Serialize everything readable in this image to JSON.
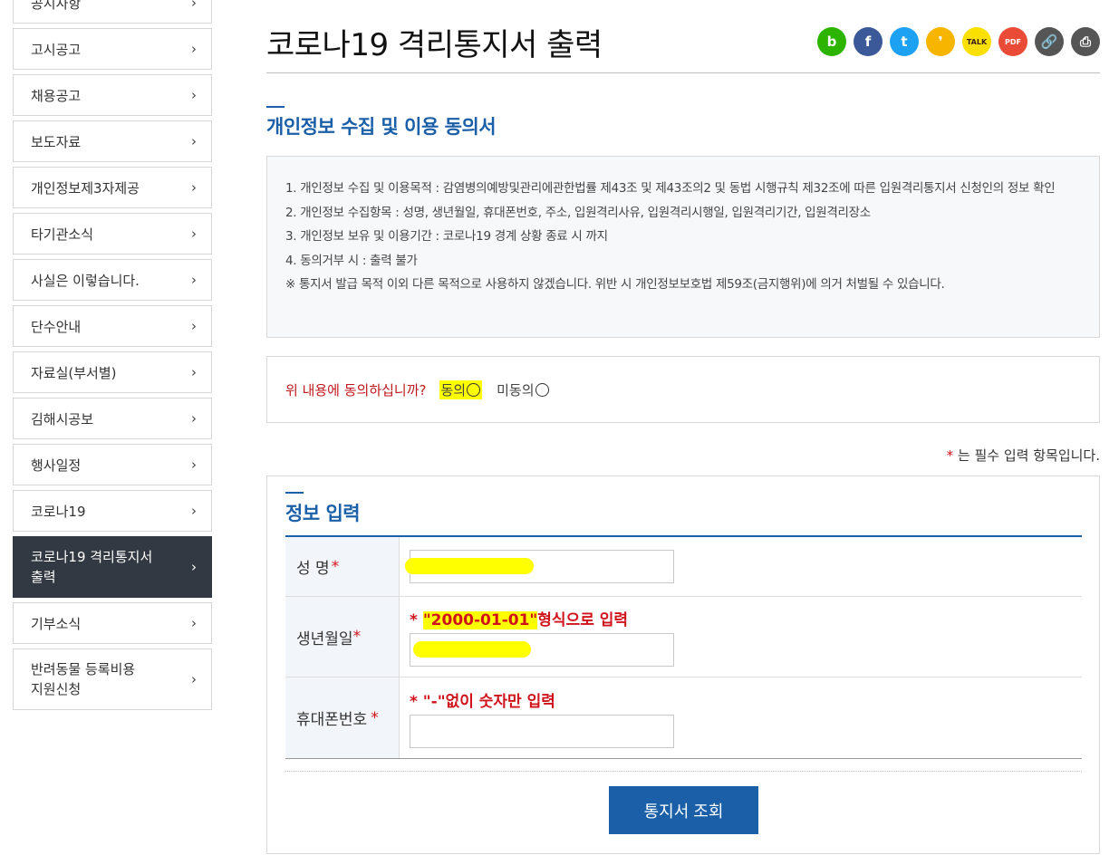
{
  "sidebar": {
    "items": [
      {
        "label": "공시사항"
      },
      {
        "label": "고시공고"
      },
      {
        "label": "채용공고"
      },
      {
        "label": "보도자료"
      },
      {
        "label": "개인정보제3자제공"
      },
      {
        "label": "타기관소식"
      },
      {
        "label": "사실은 이렇습니다."
      },
      {
        "label": "단수안내"
      },
      {
        "label": "자료실(부서별)"
      },
      {
        "label": "김해시공보"
      },
      {
        "label": "행사일정"
      },
      {
        "label": "코로나19"
      },
      {
        "label": "코로나19 격리통지서\n출력",
        "active": true
      },
      {
        "label": "기부소식"
      },
      {
        "label": "반려동물 등록비용\n지원신청"
      }
    ],
    "chevron": "›"
  },
  "page": {
    "title": "코로나19 격리통지서 출력"
  },
  "share": [
    {
      "icon": "band-icon",
      "glyph": "b",
      "color": "#2db400"
    },
    {
      "icon": "facebook-icon",
      "glyph": "f",
      "color": "#3b5998"
    },
    {
      "icon": "twitter-icon",
      "glyph": "t",
      "color": "#1da1f2"
    },
    {
      "icon": "kakaostory-icon",
      "glyph": "❜",
      "color": "#f8b500"
    },
    {
      "icon": "kakaotalk-icon",
      "glyph": "TALK",
      "color": "#f9e000"
    },
    {
      "icon": "pdf-icon",
      "glyph": "PDF",
      "color": "#e94b36"
    },
    {
      "icon": "link-icon",
      "glyph": "🔗",
      "color": "#555555"
    },
    {
      "icon": "print-icon",
      "glyph": "⎙",
      "color": "#555555"
    }
  ],
  "privacy": {
    "title": "개인정보 수집 및 이용 동의서",
    "lines": [
      "1. 개인정보 수집 및 이용목적 : 감염병의예방및관리에관한법률 제43조 및 제43조의2 및 동법 시행규칙 제32조에 따른 입원격리통지서 신청인의 정보 확인",
      "2. 개인정보 수집항목 : 성명, 생년월일, 휴대폰번호, 주소, 입원격리사유, 입원격리시행일, 입원격리기간, 입원격리장소",
      "3. 개인정보 보유 및 이용기간 : 코로나19 경계 상황 종료 시 까지",
      "4. 동의거부 시 : 출력 불가",
      "※ 통지서 발급 목적 이외 다른 목적으로 사용하지 않겠습니다. 위반 시 개인정보보호법 제59조(금지행위)에 의거 처벌될 수 있습니다."
    ]
  },
  "agree": {
    "question": "위 내용에 동의하십니까?",
    "yes_label": "동의",
    "no_label": "미동의"
  },
  "required_note": {
    "star": "*",
    "text": " 는 필수 입력 항목입니다."
  },
  "form": {
    "title": "정보 입력",
    "name_label": "성 명",
    "birth_label": "생년월일",
    "birth_hint_star": "* ",
    "birth_hint_fmt": "\"2000-01-01\"",
    "birth_hint_tail": "형식으로 입력",
    "phone_label": "휴대폰번호",
    "phone_hint": "* \"-\"없이 숫자만 입력",
    "star": "*",
    "name_value": "",
    "birth_value": "",
    "phone_value": "",
    "submit_label": "통지서 조회"
  },
  "colors": {
    "accent": "#1a5fa8",
    "required": "#d0121b",
    "active_menu": "#333942"
  }
}
